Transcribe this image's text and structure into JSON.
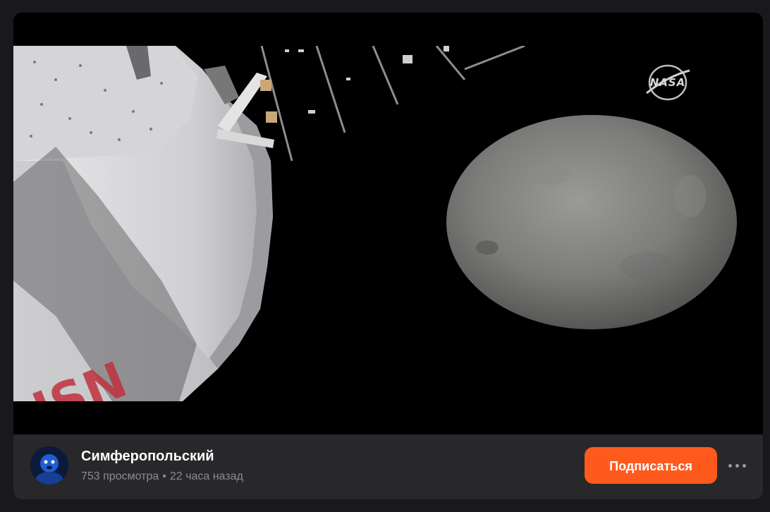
{
  "video": {
    "watermark": "NASA",
    "hull_lettering": "ISN"
  },
  "channel": {
    "name": "Симферопольский",
    "avatar_icon": "avatar-face-icon"
  },
  "meta": {
    "views": "753 просмотра",
    "separator": "•",
    "time_ago": "22 часа назад"
  },
  "actions": {
    "subscribe_label": "Подписаться",
    "more_icon": "more-dots-icon"
  },
  "colors": {
    "accent": "#ff5a1e",
    "card_bg": "#28282b",
    "page_bg": "#19191b"
  }
}
